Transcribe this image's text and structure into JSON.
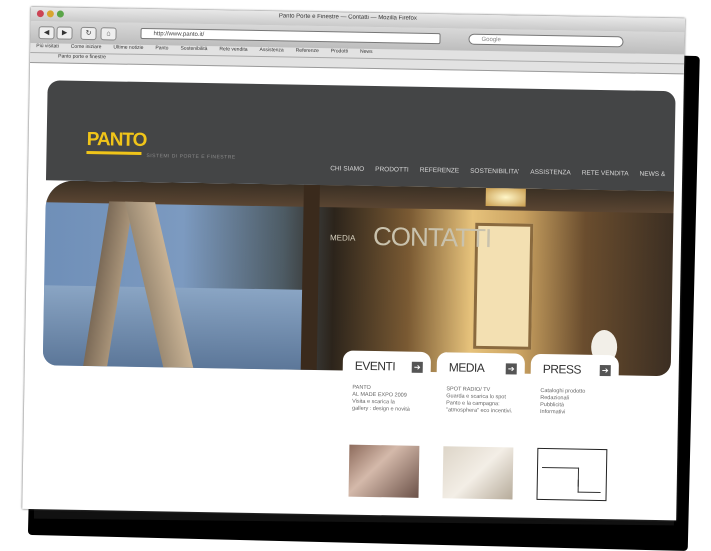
{
  "browser": {
    "title": "Panto Porte e Finestre — Contatti — Mozilla Firefox",
    "url": "http://www.panto.it/",
    "search_placeholder": "Google",
    "back_glyph": "◀",
    "forward_glyph": "▶",
    "bookmarks": [
      "Più visitati",
      "Come iniziare",
      "Ultime notizie",
      "Panto",
      "Sostenibilità",
      "Rete vendita",
      "Assistenza",
      "Referenze",
      "Prodotti",
      "News"
    ],
    "tab_label": "Panto porte e finestre"
  },
  "site": {
    "logo": "PANTO",
    "tagline": "SISTEMI DI PORTE E FINESTRE",
    "nav": [
      "CHI SIAMO",
      "PRODOTTI",
      "REFERENZE",
      "SOSTENIBILITA'",
      "ASSISTENZA",
      "RETE VENDITA",
      "NEWS &"
    ],
    "hero_small": "MEDIA",
    "hero_title": "CONTATTI"
  },
  "cards": [
    {
      "title": "EVENTI",
      "arrow": "➔",
      "lines": [
        "PANTO",
        "AL MADE EXPO  2009",
        "Visita e scarica la",
        "gallery : design e novità"
      ],
      "thumb_icon": "event-photo-icon"
    },
    {
      "title": "MEDIA",
      "arrow": "➔",
      "lines": [
        "SPOT RADIO/ TV",
        "Guarda e scarica lo spot",
        "Panto e la campagna:",
        "\"atmosphera\" eco incentivi."
      ],
      "thumb_icon": "media-photo-icon"
    },
    {
      "title": "PRESS",
      "arrow": "➔",
      "lines": [
        "Cataloghi prodotto",
        "Redazionali",
        "Pubblicità",
        "Informativi"
      ],
      "thumb_icon": "press-drawing-icon"
    }
  ],
  "colors": {
    "brand": "#f0c419",
    "header": "#444546"
  }
}
